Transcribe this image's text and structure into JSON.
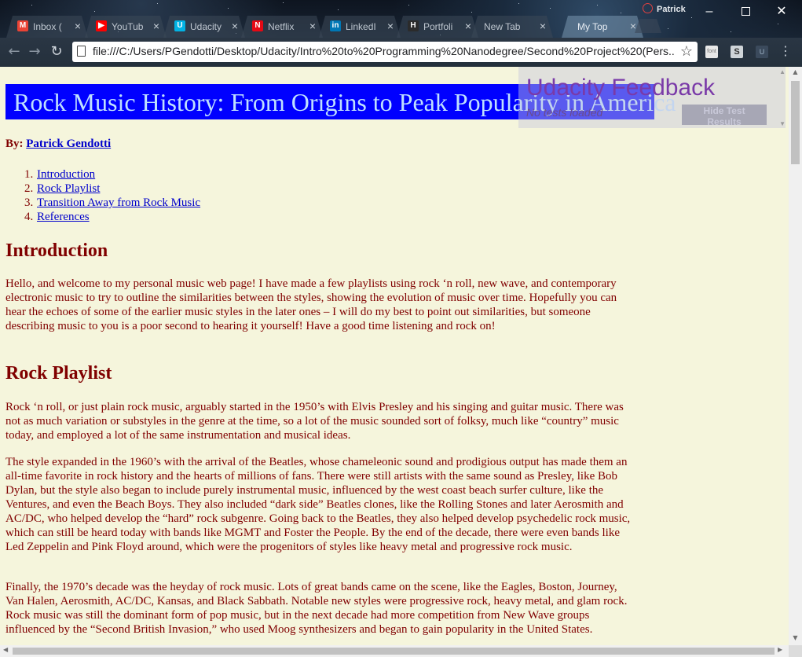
{
  "browser": {
    "profile_name": "Patrick",
    "tabs": [
      {
        "label": "Inbox (",
        "icon": "gmail-icon",
        "icon_color": "#ea4335",
        "icon_glyph": "M"
      },
      {
        "label": "YouTub",
        "icon": "youtube-icon",
        "icon_color": "#ff0000",
        "icon_glyph": "▶"
      },
      {
        "label": "Udacity",
        "icon": "udacity-icon",
        "icon_color": "#02b3e4",
        "icon_glyph": "U"
      },
      {
        "label": "Netflix",
        "icon": "netflix-icon",
        "icon_color": "#e50914",
        "icon_glyph": "N"
      },
      {
        "label": "LinkedI",
        "icon": "linkedin-icon",
        "icon_color": "#0077b5",
        "icon_glyph": "in"
      },
      {
        "label": "Portfoli",
        "icon": "hackerrank-icon",
        "icon_color": "#2b2b2b",
        "icon_glyph": "H"
      },
      {
        "label": "New Tab",
        "icon": "",
        "icon_color": "",
        "icon_glyph": ""
      },
      {
        "label": "My Top",
        "icon": "",
        "icon_color": "",
        "icon_glyph": "",
        "active": true
      }
    ],
    "url": "file:///C:/Users/PGendotti/Desktop/Udacity/Intro%20to%20Programming%20Nanodegree/Second%20Project%20(Pers..."
  },
  "feedback": {
    "title": "Udacity Feedback",
    "status": "No tests loaded",
    "button": "Hide Test Results"
  },
  "page": {
    "title": "Rock Music History: From Origins to Peak Popularity in America",
    "byline_label": "By:",
    "author": "Patrick Gendotti",
    "toc": [
      {
        "num": "1.",
        "label": "Introduction"
      },
      {
        "num": "2.",
        "label": "Rock Playlist"
      },
      {
        "num": "3.",
        "label": "Transition Away from Rock Music"
      },
      {
        "num": "4.",
        "label": "References"
      }
    ],
    "intro_heading": "Introduction",
    "intro_text": "Hello, and welcome to my personal music web page! I have made a few playlists using rock ‘n roll, new wave, and contemporary electronic music to try to outline the similarities between the styles, showing the evolution of music over time. Hopefully you can hear the echoes of some of the earlier music styles in the later ones – I will do my best to point out similarities, but someone describing music to you is a poor second to hearing it yourself! Have a good time listening and rock on!",
    "playlist_heading": "Rock Playlist",
    "playlist_p1": "Rock ‘n roll, or just plain rock music, arguably started in the 1950’s with Elvis Presley and his singing and guitar music. There was not as much variation or substyles in the genre at the time, so a lot of the music sounded sort of folksy, much like “country” music today, and employed a lot of the same instrumentation and musical ideas.",
    "playlist_p2": "The style expanded in the 1960’s with the arrival of the Beatles, whose chameleonic sound and prodigious output has made them an all-time favorite in rock history and the hearts of millions of fans. There were still artists with the same sound as Presley, like Bob Dylan, but the style also began to include purely instrumental music, influenced by the west coast beach surfer culture, like the Ventures, and even the Beach Boys. They also included “dark side” Beatles clones, like the Rolling Stones and later Aerosmith and AC/DC, who helped develop the “hard” rock subgenre. Going back to the Beatles, they also helped develop psychedelic rock music, which can still be heard today with bands like MGMT and Foster the People. By the end of the decade, there were even bands like Led Zeppelin and Pink Floyd around, which were the progenitors of styles like heavy metal and progressive rock music.",
    "playlist_p3": "Finally, the 1970’s decade was the heyday of rock music. Lots of great bands came on the scene, like the Eagles, Boston, Journey, Van Halen, Aerosmith, AC/DC, Kansas, and Black Sabbath. Notable new styles were progressive rock, heavy metal, and glam rock. Rock music was still the dominant form of pop music, but in the next decade had more competition from New Wave groups influenced by the “Second British Invasion,” who used Moog synthesizers and began to gain popularity in the United States."
  },
  "colors": {
    "page_background": "#f5f5dc",
    "banner_background": "#0000ff",
    "text": "#800000",
    "link": "#0000cc"
  }
}
